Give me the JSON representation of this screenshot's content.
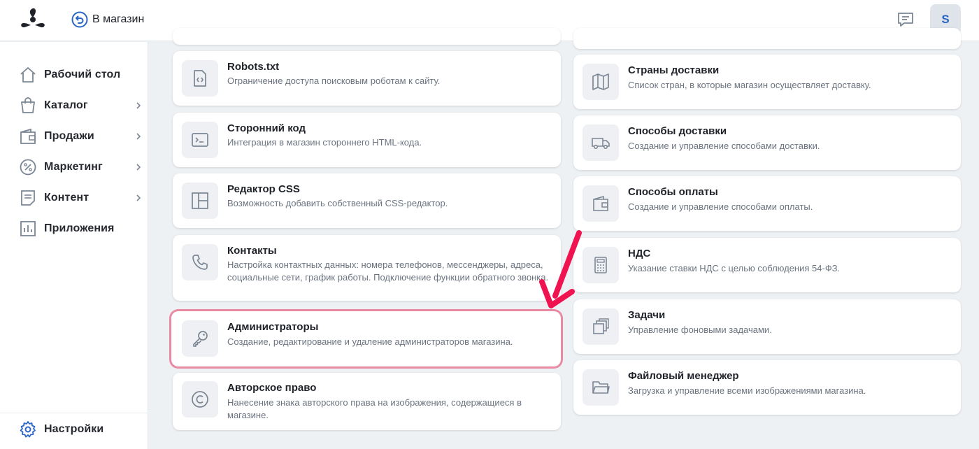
{
  "header": {
    "back_label": "В магазин",
    "avatar_letter": "S"
  },
  "sidebar": {
    "items": [
      {
        "label": "Рабочий стол",
        "icon": "home-icon",
        "has_submenu": false
      },
      {
        "label": "Каталог",
        "icon": "bag-icon",
        "has_submenu": true
      },
      {
        "label": "Продажи",
        "icon": "wallet-icon",
        "has_submenu": true
      },
      {
        "label": "Маркетинг",
        "icon": "percent-icon",
        "has_submenu": true
      },
      {
        "label": "Контент",
        "icon": "document-icon",
        "has_submenu": true
      },
      {
        "label": "Приложения",
        "icon": "chart-icon",
        "has_submenu": false
      }
    ],
    "settings_label": "Настройки"
  },
  "left_cards": [
    {
      "title": "Robots.txt",
      "desc": "Ограничение доступа поисковым роботам к сайту.",
      "icon": "code-file-icon"
    },
    {
      "title": "Сторонний код",
      "desc": "Интеграция в магазин стороннего HTML-кода.",
      "icon": "terminal-icon"
    },
    {
      "title": "Редактор CSS",
      "desc": "Возможность добавить собственный CSS-редактор.",
      "icon": "layout-icon"
    },
    {
      "title": "Контакты",
      "desc": "Настройка контактных данных: номера телефонов, мессенджеры, адреса, социальные сети, график работы. Подключение функции обратного звонка.",
      "icon": "phone-icon"
    },
    {
      "title": "Администраторы",
      "desc": "Создание, редактирование и удаление администраторов магазина.",
      "icon": "key-icon"
    },
    {
      "title": "Авторское право",
      "desc": "Нанесение знака авторского права на изображения, содержащиеся в магазине.",
      "icon": "copyright-icon"
    }
  ],
  "right_cards": [
    {
      "title": "Страны доставки",
      "desc": "Список стран, в которые магазин осуществляет доставку.",
      "icon": "map-icon"
    },
    {
      "title": "Способы доставки",
      "desc": "Создание и управление способами доставки.",
      "icon": "truck-icon"
    },
    {
      "title": "Способы оплаты",
      "desc": "Создание и управление способами оплаты.",
      "icon": "wallet-icon"
    },
    {
      "title": "НДС",
      "desc": "Указание ставки НДС с целью соблюдения 54-ФЗ.",
      "icon": "calculator-icon"
    },
    {
      "title": "Задачи",
      "desc": "Управление фоновыми задачами.",
      "icon": "stack-icon"
    },
    {
      "title": "Файловый менеджер",
      "desc": "Загрузка и управление всеми изображениями магазина.",
      "icon": "folder-icon"
    }
  ],
  "colors": {
    "accent": "#2a66c6",
    "highlight_border": "#e98aa3",
    "arrow": "#f0134f",
    "background": "#eef1f4",
    "icon_gray": "#7b8694"
  }
}
